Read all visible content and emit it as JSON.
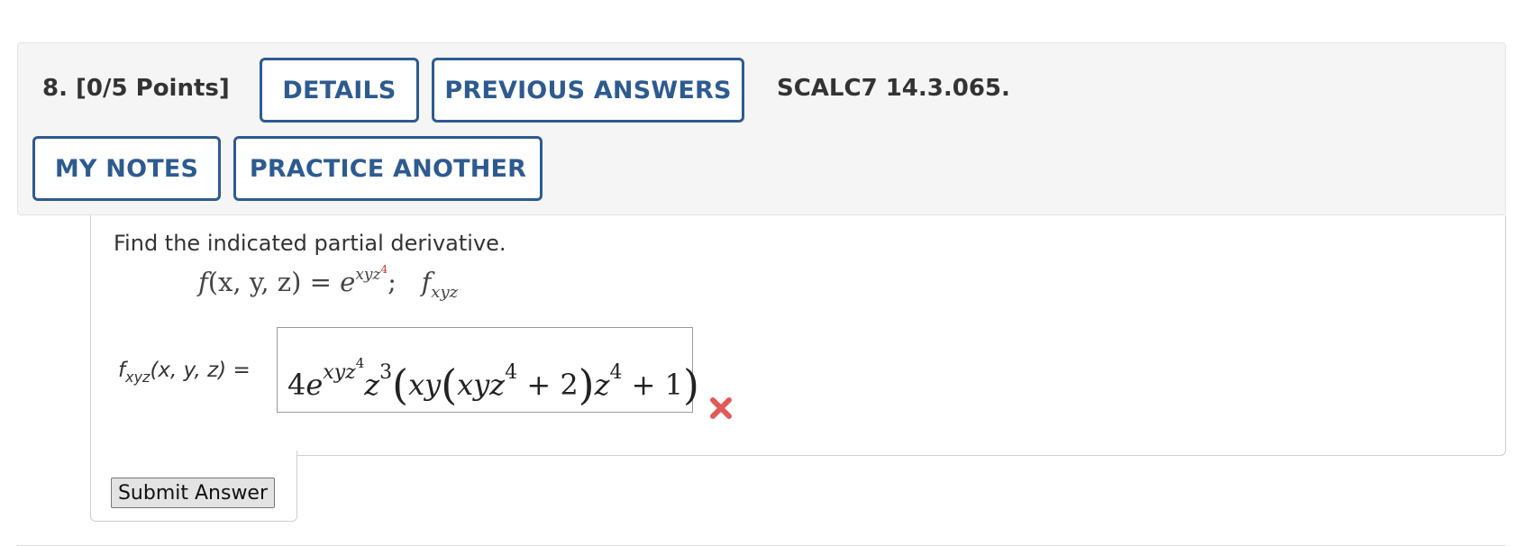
{
  "question": {
    "number_points": "8. [0/5 Points]",
    "code": "SCALC7 14.3.065."
  },
  "buttons": {
    "details": "DETAILS",
    "previous_answers": "PREVIOUS ANSWERS",
    "my_notes": "MY NOTES",
    "practice_another": "PRACTICE ANOTHER",
    "submit": "Submit Answer"
  },
  "problem": {
    "prompt": "Find the indicated partial derivative.",
    "function_name": "f",
    "function_args": "(x, y, z)",
    "equals": " = ",
    "base": "e",
    "exponent": "xyz",
    "exponent_power": "4",
    "separator": ";",
    "target_symbol": "f",
    "target_subscript": "xyz"
  },
  "answer": {
    "label_f": "f",
    "label_sub": "xyz",
    "label_args": "(x, y, z) =",
    "value_text": "4e^(xyz^4) z^3 (xy(xyz^4 + 2)z^4 + 1)",
    "coef": "4",
    "e": "e",
    "exp": "xyz",
    "exp_pow": "4",
    "z": "z",
    "z_pow": "3",
    "lparen": "(",
    "xy": "xy",
    "inner_lparen": "(",
    "inner": "xyz",
    "inner_pow": "4",
    "plus_two": " + 2",
    "inner_rparen": ")",
    "z2": "z",
    "z2_pow": "4",
    "plus_one": " + 1",
    "rparen": ")",
    "status": "incorrect",
    "status_icon": "x-mark-icon",
    "status_color": "#e05a5a"
  },
  "colors": {
    "accent": "#2e5b8f",
    "panel_bg": "#f5f5f5"
  }
}
